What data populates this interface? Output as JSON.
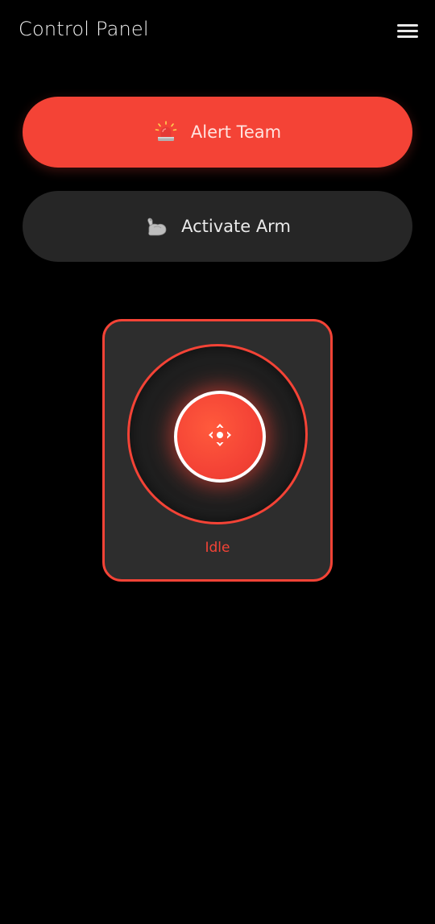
{
  "header": {
    "title": "Control Panel",
    "menu_icon": "hamburger-menu-icon"
  },
  "actions": {
    "alert": {
      "label": "Alert Team",
      "icon": "siren-icon",
      "color": "#f44336"
    },
    "arm": {
      "label": "Activate Arm",
      "icon": "flexed-arm-icon",
      "color": "#262626"
    }
  },
  "joystick": {
    "icon": "move-arrows-icon",
    "status": "Idle",
    "accent": "#f44336",
    "card_bg": "#2d2d2d"
  }
}
